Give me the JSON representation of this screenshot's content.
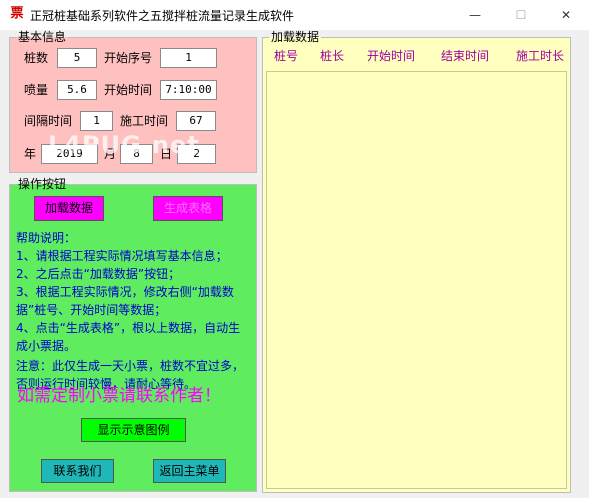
{
  "window": {
    "icon": "票",
    "title": "正冠桩基础系列软件之五搅拌桩流量记录生成软件",
    "minimize": "—",
    "maximize": "☐",
    "close": "✕"
  },
  "basic_info": {
    "legend": "基本信息",
    "pile_no_label": "桩数",
    "pile_no_value": "5",
    "start_seq_label": "开始序号",
    "start_seq_value": "1",
    "spray_label": "喷量",
    "spray_value": "5.6",
    "start_time_label": "开始时间",
    "start_time_value": "7:10:00",
    "interval_label": "间隔时间",
    "interval_value": "1",
    "build_time_label": "施工时间",
    "build_time_value": "67",
    "year_label": "年",
    "year_value": "2019",
    "month_label": "月",
    "month_value": "8",
    "day_label": "日",
    "day_value": "2"
  },
  "operations": {
    "legend": "操作按钮",
    "load_button": "加载数据",
    "generate_button": "生成表格",
    "help_title": "帮助说明：",
    "help_lines": [
      "1、请根据工程实际情况填写基本信息；",
      "2、之后点击“加载数据”按钮；",
      "3、根据工程实际情况，修改右侧“加载数据”桩号、开始时间等数据；",
      "4、点击“生成表格”，根以上数据，自动生成小票据。"
    ],
    "note": "注意：此仅生成一天小票，桩数不宜过多，否则运行时间较慢，请耐心等待。",
    "promo": "如需定制小票请联系作者！",
    "show_example_button": "显示示意图例",
    "contact_button": "联系我们",
    "back_button": "返回主菜单"
  },
  "data_panel": {
    "legend": "加载数据",
    "columns": [
      "桩号",
      "桩长",
      "开始时间",
      "结束时间",
      "施工时长"
    ]
  },
  "watermark": "L4PUG.net"
}
